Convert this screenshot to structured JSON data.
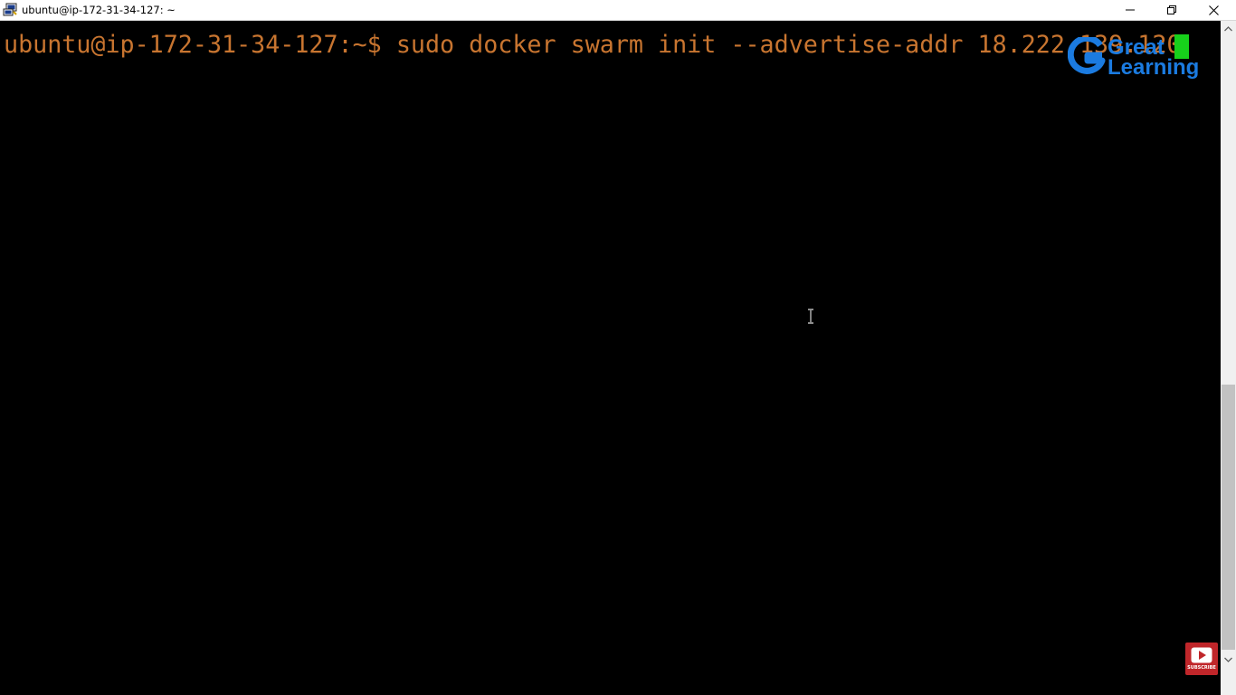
{
  "window": {
    "title": "ubuntu@ip-172-31-34-127: ~",
    "app_icon": "putty-icon",
    "controls": {
      "minimize": "minimize-icon",
      "restore": "restore-icon",
      "close": "close-icon"
    }
  },
  "terminal": {
    "prompt": "ubuntu@ip-172-31-34-127:~$ ",
    "command": "sudo docker swarm init --advertise-addr 18.222.139.120",
    "text_color": "#c87530",
    "cursor_color": "#17d11b",
    "background": "#000000"
  },
  "overlay": {
    "logo_line1": "Great",
    "logo_line2": "Learning",
    "logo_color": "#1b7be0",
    "subscribe_label": "SUBSCRIBE",
    "subscribe_color": "#c0262a"
  },
  "scrollbar": {
    "up_icon": "scroll-up-arrow-icon",
    "down_icon": "scroll-down-arrow-icon"
  }
}
